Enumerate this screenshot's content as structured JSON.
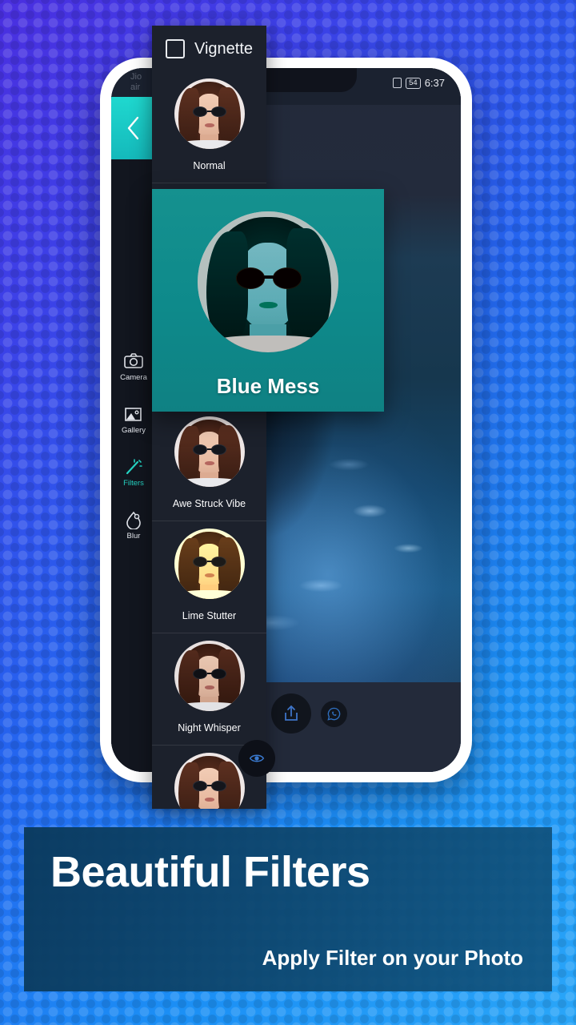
{
  "background": {
    "gradient_from": "#4a2fe0",
    "gradient_to": "#2aa6f8",
    "pattern": "halftone-dots"
  },
  "phone": {
    "app_title_line1": "Jio",
    "app_title_line2": "air",
    "status_bar": {
      "battery": "54",
      "time": "6:37"
    },
    "back_button_icon": "chevron-left-icon",
    "back_button_color": "#1fd8cf"
  },
  "toolbar": {
    "items": [
      {
        "label": "Camera",
        "icon": "camera-icon",
        "active": false
      },
      {
        "label": "Gallery",
        "icon": "gallery-icon",
        "active": false
      },
      {
        "label": "Filters",
        "icon": "magic-wand-icon",
        "active": true
      },
      {
        "label": "Blur",
        "icon": "blur-drop-icon",
        "active": false
      }
    ],
    "active_color": "#25d3c2"
  },
  "actions": {
    "share_label": "share-icon",
    "whatsapp_label": "whatsapp-icon",
    "eye_label": "eye-icon"
  },
  "filter_panel": {
    "header": {
      "checkbox_label": "Vignette",
      "checked": false
    },
    "filters": [
      {
        "name": "Normal",
        "tint": "none"
      },
      {
        "name": "Awe Struck Vibe",
        "tint": "none"
      },
      {
        "name": "Lime Stutter",
        "tint": "lime"
      },
      {
        "name": "Night Whisper",
        "tint": "night"
      },
      {
        "name": "",
        "tint": "none"
      }
    ]
  },
  "preview_card": {
    "name": "Blue Mess",
    "background_color": "#0e8a8b"
  },
  "banner": {
    "title": "Beautiful Filters",
    "subtitle": "Apply Filter on your Photo",
    "background_color": "#0e4870"
  }
}
